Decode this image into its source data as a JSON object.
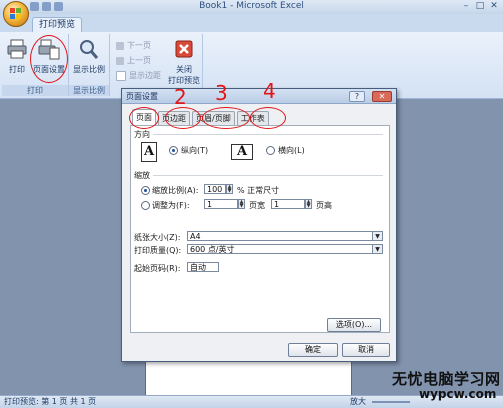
{
  "window": {
    "title": "Book1 - Microsoft Excel",
    "controls": [
      "–",
      "□",
      "✕"
    ]
  },
  "ribbon": {
    "tab": "打印预览",
    "groups": {
      "print": {
        "label": "打印",
        "print_button": "打印",
        "page_setup_button": "页面设置"
      },
      "zoom": {
        "label": "显示比例",
        "zoom_button": "显示比例"
      },
      "preview": {
        "next_page": "下一页",
        "prev_page": "上一页",
        "show_margins": "显示边距",
        "close_button_line1": "关闭",
        "close_button_line2": "打印预览"
      }
    }
  },
  "dialog": {
    "title": "页面设置",
    "help": "?",
    "close": "✕",
    "tabs": [
      "页面",
      "页边距",
      "页眉/页脚",
      "工作表"
    ],
    "orientation": {
      "heading": "方向",
      "portrait": "纵向(T)",
      "landscape": "横向(L)",
      "icon_letter": "A"
    },
    "scaling": {
      "heading": "缩放",
      "adjust_to_label": "缩放比例(A):",
      "adjust_to_value": "100",
      "adjust_to_suffix": "% 正常尺寸",
      "fit_to_label": "调整为(F):",
      "pages_wide_value": "1",
      "pages_wide_suffix": "页宽",
      "pages_tall_value": "1",
      "pages_tall_suffix": "页高"
    },
    "paper_size_label": "纸张大小(Z):",
    "paper_size_value": "A4",
    "print_quality_label": "打印质量(Q):",
    "print_quality_value": "600 点/英寸",
    "first_page_label": "起始页码(R):",
    "first_page_value": "自动",
    "options_button": "选项(O)...",
    "ok_button": "确定",
    "cancel_button": "取消"
  },
  "annotations": {
    "numbers": [
      "2",
      "3",
      "4"
    ]
  },
  "statusbar": {
    "text": "打印预览: 第 1 页 共 1 页",
    "zoom_label": "放大"
  },
  "watermark": {
    "title": "无忧电脑学习网",
    "domain": "wypcw.com"
  },
  "colors": {
    "annotation_red": "#e0161a",
    "ribbon_blue": "#d4e2f4"
  }
}
